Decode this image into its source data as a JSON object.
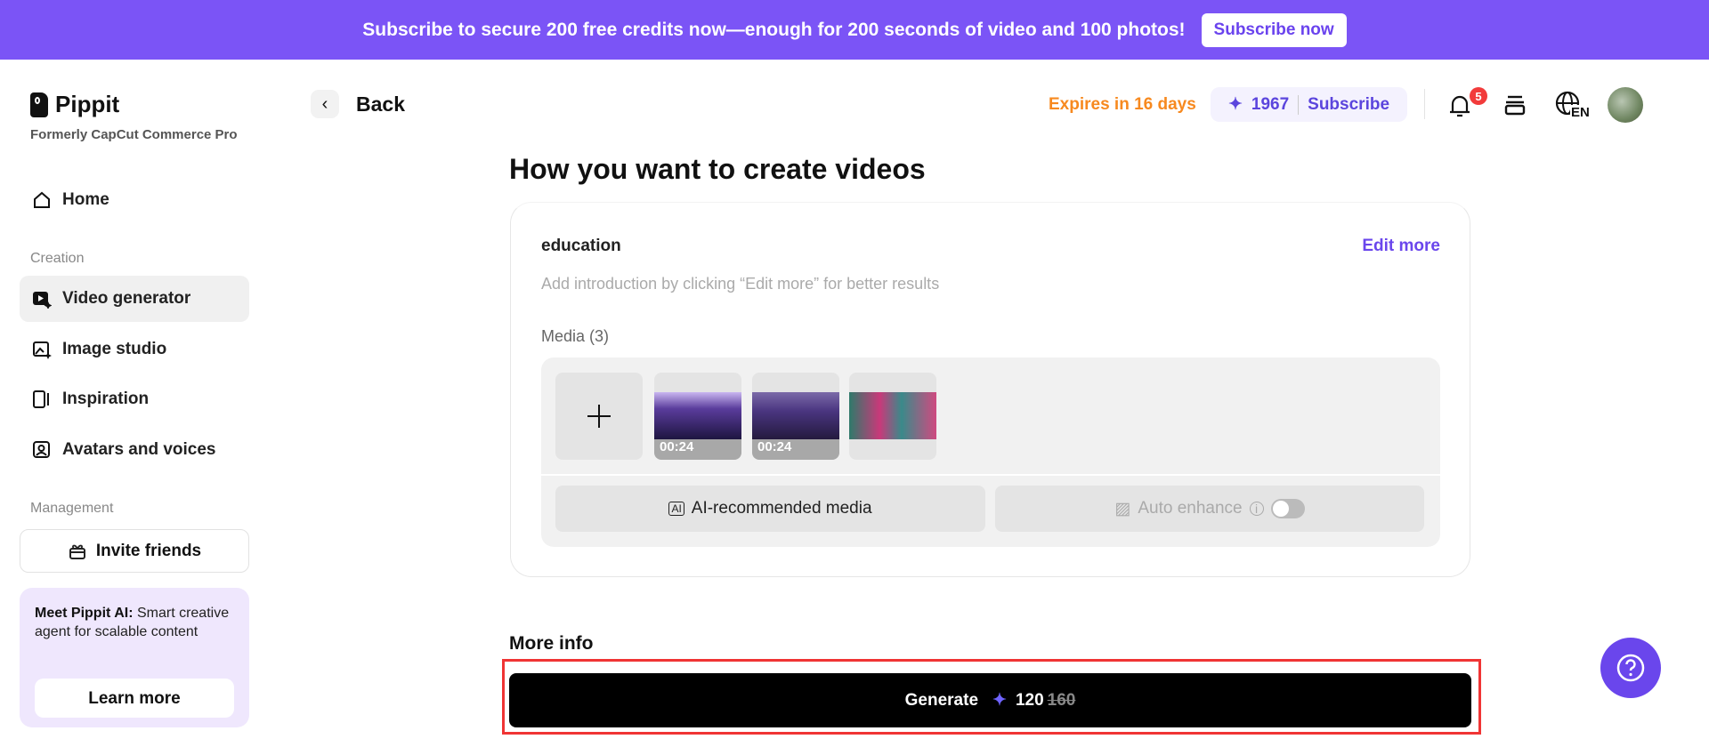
{
  "banner": {
    "text": "Subscribe to secure 200 free credits now—enough for 200 seconds of video and 100 photos!",
    "button": "Subscribe now"
  },
  "brand": {
    "name": "Pippit",
    "subtitle": "Formerly CapCut Commerce Pro"
  },
  "sidebar": {
    "home": "Home",
    "creation_label": "Creation",
    "items": [
      {
        "label": "Video generator",
        "icon": "video-sparkle-icon"
      },
      {
        "label": "Image studio",
        "icon": "image-sparkle-icon"
      },
      {
        "label": "Inspiration",
        "icon": "inspiration-icon"
      },
      {
        "label": "Avatars and voices",
        "icon": "avatar-icon"
      }
    ],
    "management_label": "Management",
    "invite": "Invite friends",
    "promo": {
      "bold": "Meet Pippit AI:",
      "text": " Smart creative agent for scalable content",
      "button": "Learn more"
    }
  },
  "header": {
    "back": "Back",
    "expires": "Expires in 16 days",
    "credits": "1967",
    "subscribe": "Subscribe",
    "notifications": "5",
    "language": "EN"
  },
  "main": {
    "title": "How you want to create videos",
    "topic": "education",
    "edit_more": "Edit more",
    "intro_placeholder": "Add introduction by clicking “Edit more” for better results",
    "media_label": "Media (3)",
    "media": [
      {
        "duration": "00:24"
      },
      {
        "duration": "00:24"
      },
      {
        "duration": ""
      }
    ],
    "ai_media": "AI-recommended media",
    "auto_enhance": "Auto enhance",
    "auto_enhance_on": false,
    "more_info": "More info",
    "generate": "Generate",
    "cost": "120",
    "original_cost": "160"
  },
  "colors": {
    "accent": "#7b54f6",
    "orange": "#f7891f",
    "badge": "#f23b3b"
  }
}
